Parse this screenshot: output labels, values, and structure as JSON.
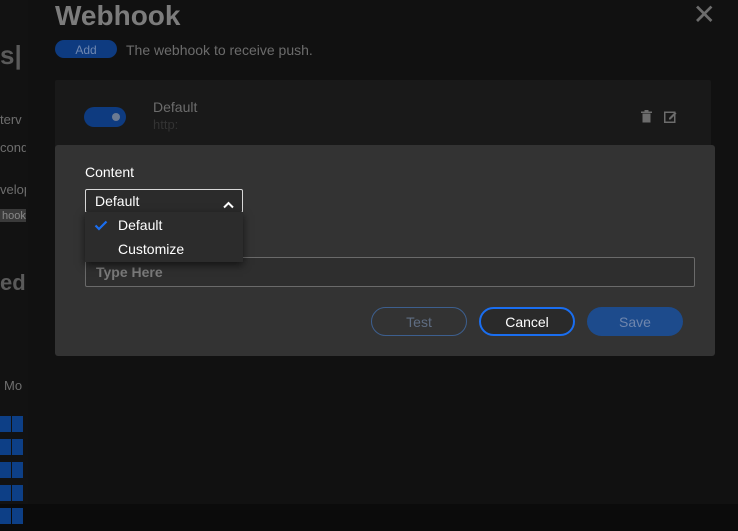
{
  "background": {
    "fragments": [
      "s|",
      "terv",
      "cond",
      "velop",
      "hook",
      "ed",
      "Mo"
    ]
  },
  "panel": {
    "title": "Webhook",
    "add_label": "Add",
    "description": "The webhook to receive push.",
    "webhook": {
      "name": "Default",
      "url": "http:"
    }
  },
  "modal": {
    "content_label": "Content",
    "select_value": "Default",
    "options": [
      "Default",
      "Customize"
    ],
    "selected_option": "Default",
    "input_placeholder": "Type Here",
    "test_label": "Test",
    "cancel_label": "Cancel",
    "save_label": "Save"
  },
  "colors": {
    "accent": "#1a6ef0",
    "modal_bg": "#333333",
    "panel_bg": "#111111"
  },
  "icons": {
    "close": "close-icon",
    "delete": "trash-icon",
    "edit": "edit-icon",
    "select_chevron": "chevron-up-icon",
    "selected": "check-icon"
  }
}
